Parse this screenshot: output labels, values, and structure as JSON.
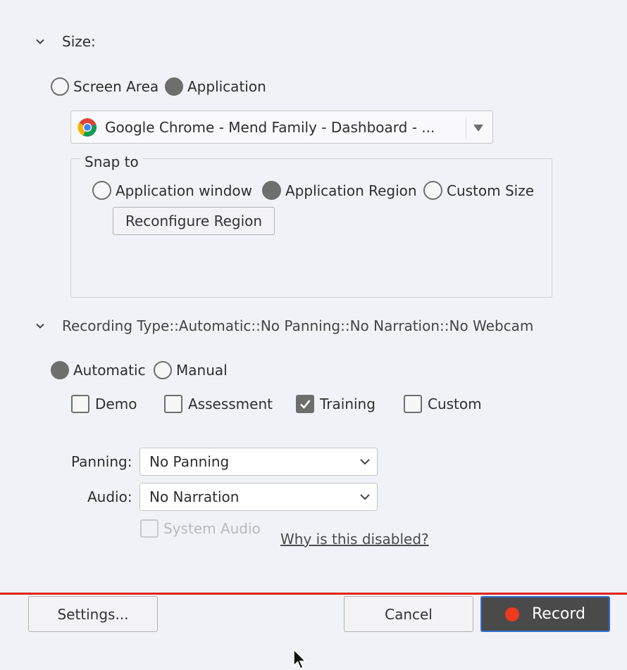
{
  "size_section": {
    "title": "Size:",
    "mode_options": [
      {
        "label": "Screen Area",
        "selected": false
      },
      {
        "label": "Application",
        "selected": true
      }
    ],
    "app_dropdown": {
      "value": "Google Chrome - Mend Family - Dashboard - ...",
      "icon": "chrome-icon"
    },
    "snap": {
      "legend": "Snap to",
      "options": [
        {
          "label": "Application window",
          "selected": false
        },
        {
          "label": "Application Region",
          "selected": true
        },
        {
          "label": "Custom Size",
          "selected": false
        }
      ],
      "reconfigure_label": "Reconfigure Region"
    }
  },
  "recording_section": {
    "title": "Recording Type::Automatic::No Panning::No Narration::No Webcam",
    "mode_options": [
      {
        "label": "Automatic",
        "selected": true
      },
      {
        "label": "Manual",
        "selected": false
      }
    ],
    "types": [
      {
        "label": "Demo",
        "checked": false
      },
      {
        "label": "Assessment",
        "checked": false
      },
      {
        "label": "Training",
        "checked": true
      },
      {
        "label": "Custom",
        "checked": false
      }
    ],
    "panning": {
      "label": "Panning:",
      "value": "No Panning"
    },
    "audio": {
      "label": "Audio:",
      "value": "No Narration"
    },
    "system_audio": {
      "label": "System Audio",
      "checked": false,
      "disabled": true
    },
    "why_disabled_link": "Why is this disabled?"
  },
  "footer": {
    "settings_label": "Settings...",
    "cancel_label": "Cancel",
    "record_label": "Record"
  },
  "colors": {
    "background": "#f1f2f7",
    "divider": "#e0231b",
    "record_button": "#4a4a4a",
    "record_dot": "#ee3a1e",
    "focus_border": "#2f6fcf"
  }
}
